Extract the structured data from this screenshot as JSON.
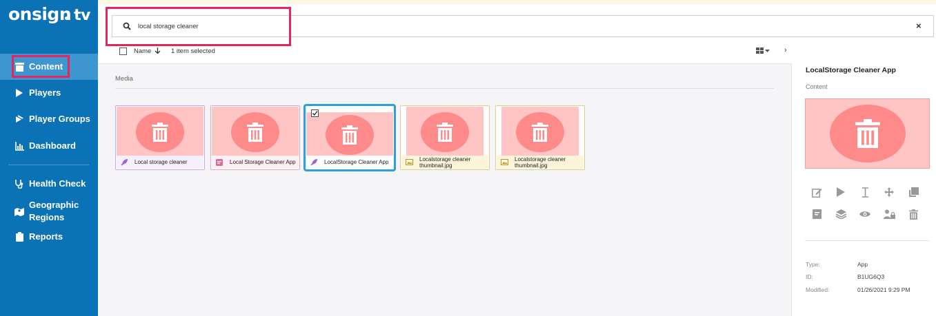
{
  "brand": {
    "logo_main": "onsign",
    "logo_suffix": "tv"
  },
  "sidebar": {
    "items": [
      {
        "label": "Content",
        "icon": "content-icon",
        "active": true
      },
      {
        "label": "Players",
        "icon": "play-icon"
      },
      {
        "label": "Player Groups",
        "icon": "player-groups-icon"
      },
      {
        "label": "Dashboard",
        "icon": "chart-icon"
      },
      {
        "label": "Health Check",
        "icon": "stethoscope-icon"
      },
      {
        "label": "Geographic Regions",
        "icon": "map-icon"
      },
      {
        "label": "Reports",
        "icon": "clipboard-icon"
      }
    ]
  },
  "search": {
    "value": "local storage cleaner",
    "clear": "×"
  },
  "toolbar": {
    "sort_label": "Name",
    "selection": "1 item selected"
  },
  "section": {
    "title": "Media"
  },
  "tiles": [
    {
      "name": "Local storage cleaner",
      "kind": "app"
    },
    {
      "name": "Local Storage Cleaner App",
      "kind": "html"
    },
    {
      "name": "LocalStorage Cleaner App",
      "kind": "app",
      "selected": true
    },
    {
      "name": "Localstorage cleaner thumbnail.jpg",
      "kind": "image"
    },
    {
      "name": "Localstorage cleaner thumbnail.jpg",
      "kind": "image"
    }
  ],
  "detail": {
    "title": "LocalStorage Cleaner App",
    "subtitle": "Content",
    "type_label": "Type:",
    "type_value": "App",
    "id_label": "ID:",
    "id_value": "B1UG6Q3",
    "modified_label": "Modified:",
    "modified_value": "01/26/2021 9:29 PM"
  },
  "colors": {
    "sidebar": "#0b72b5",
    "active": "#3d96cf",
    "highlight": "#e8245c",
    "selected_border": "#2a9fe6"
  }
}
